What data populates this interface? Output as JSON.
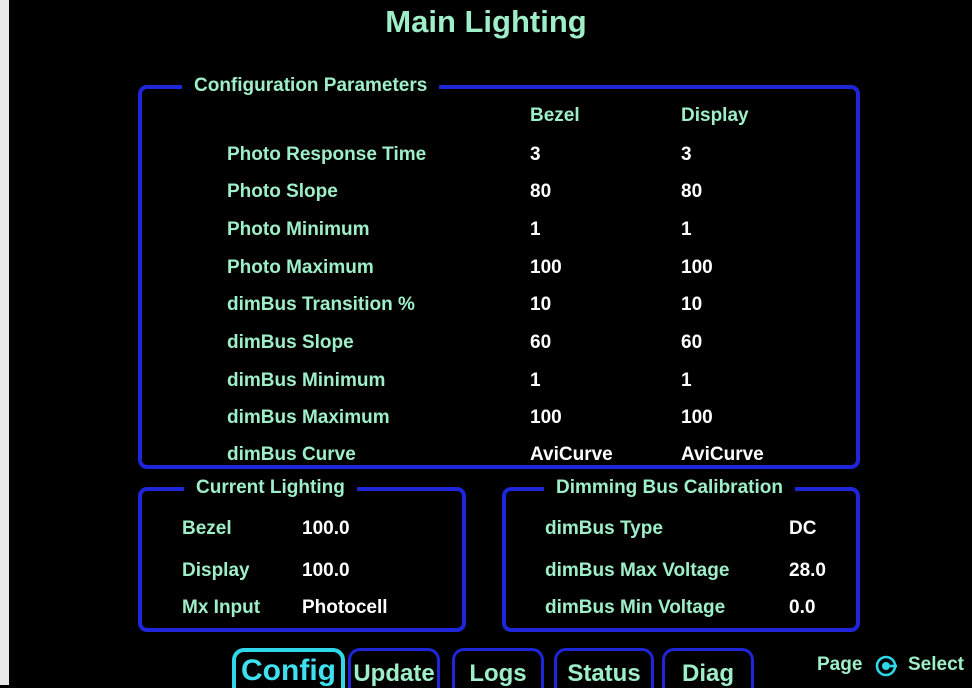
{
  "page_title": "Main Lighting",
  "config": {
    "legend": "Configuration Parameters",
    "col_bezel": "Bezel",
    "col_display": "Display",
    "rows": [
      {
        "label": "Photo Response Time",
        "bezel": "3",
        "display": "3"
      },
      {
        "label": "Photo Slope",
        "bezel": "80",
        "display": "80"
      },
      {
        "label": "Photo Minimum",
        "bezel": "1",
        "display": "1"
      },
      {
        "label": "Photo Maximum",
        "bezel": "100",
        "display": "100"
      },
      {
        "label": "dimBus Transition %",
        "bezel": "10",
        "display": "10"
      },
      {
        "label": "dimBus Slope",
        "bezel": "60",
        "display": "60"
      },
      {
        "label": "dimBus Minimum",
        "bezel": "1",
        "display": "1"
      },
      {
        "label": "dimBus Maximum",
        "bezel": "100",
        "display": "100"
      },
      {
        "label": "dimBus Curve",
        "bezel": "AviCurve",
        "display": "AviCurve"
      }
    ]
  },
  "current": {
    "legend": "Current Lighting",
    "rows": [
      {
        "label": "Bezel",
        "value": "100.0"
      },
      {
        "label": "Display",
        "value": "100.0"
      },
      {
        "label": "Mx Input",
        "value": "Photocell"
      }
    ]
  },
  "calibration": {
    "legend": "Dimming Bus Calibration",
    "rows": [
      {
        "label": "dimBus Type",
        "value": "DC"
      },
      {
        "label": "dimBus Max Voltage",
        "value": "28.0"
      },
      {
        "label": "dimBus Min Voltage",
        "value": "0.0"
      }
    ]
  },
  "tabs": [
    {
      "label": "Config"
    },
    {
      "label": "Update"
    },
    {
      "label": "Logs"
    },
    {
      "label": "Status"
    },
    {
      "label": "Diag"
    }
  ],
  "hint": {
    "page": "Page",
    "select": "Select",
    "icon": "rotary-knob-icon"
  },
  "colors": {
    "label": "#9eeec8",
    "value": "#ffffff",
    "border": "#1f25d8",
    "active_tab": "#2fd8e8",
    "background": "#000000"
  }
}
